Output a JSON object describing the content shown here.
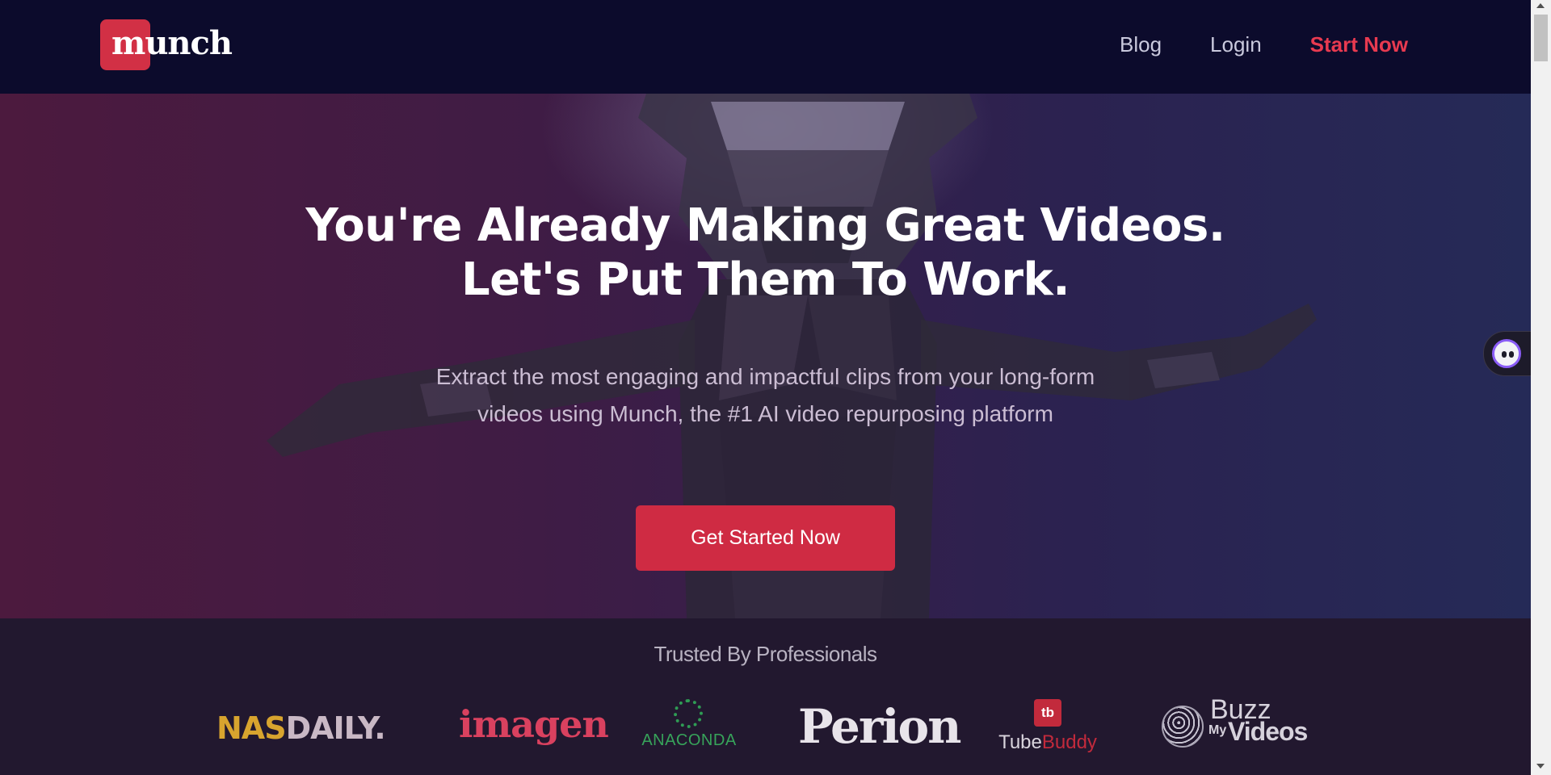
{
  "brand": {
    "logo_text": "munch",
    "accent": "#d23045"
  },
  "nav": {
    "links": [
      {
        "label": "Blog"
      },
      {
        "label": "Login"
      },
      {
        "label": "Start Now"
      }
    ]
  },
  "hero": {
    "title_line1": "You're Already Making Great Videos.",
    "title_line2": "Let's Put Them To Work.",
    "subtitle_line1": "Extract the most engaging and impactful clips from your long-form",
    "subtitle_line2": "videos using Munch, the #1 AI video repurposing platform",
    "cta_label": "Get Started Now",
    "background_image": "mirrored-costume-figure"
  },
  "trusted": {
    "title": "Trusted By Professionals",
    "logos": {
      "nasdaily_a": "NAS",
      "nasdaily_b": "DAILY.",
      "imagen": "imagen",
      "anaconda": "ANACONDA",
      "perion": "Perion",
      "tubebuddy_icon": "tb",
      "tubebuddy_a": "Tube",
      "tubebuddy_b": "Buddy",
      "buzz_a": "Buzz",
      "buzz_b": "My",
      "buzz_c": "Videos"
    }
  },
  "widget": {
    "icon": "assistant-face-icon"
  },
  "colors": {
    "nav_bg": "#0c0b2c",
    "cta_bg": "#cf2b43",
    "nav_cta": "#e83a50",
    "trusted_bg": "#22182f"
  }
}
